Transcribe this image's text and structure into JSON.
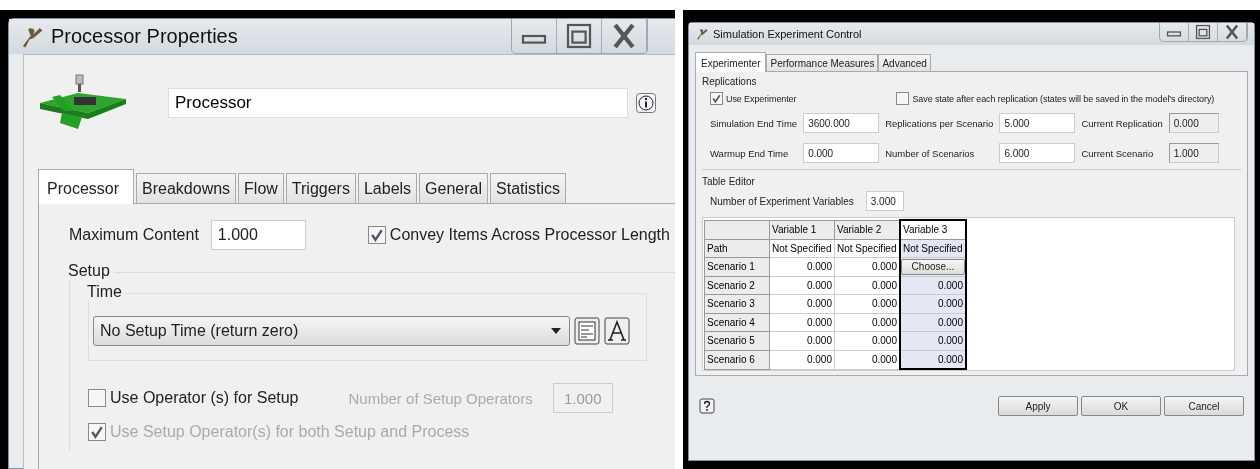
{
  "processor_properties": {
    "title": "Processor  Properties",
    "name_value": "Processor",
    "tabs": [
      {
        "label": "Processor",
        "selected": true
      },
      {
        "label": "Breakdowns",
        "selected": false
      },
      {
        "label": "Flow",
        "selected": false
      },
      {
        "label": "Triggers",
        "selected": false
      },
      {
        "label": "Labels",
        "selected": false
      },
      {
        "label": "General",
        "selected": false
      },
      {
        "label": "Statistics",
        "selected": false
      }
    ],
    "maximum_content": {
      "label": "Maximum Content",
      "value": "1.000"
    },
    "convey_items": {
      "label": "Convey Items Across Processor Length",
      "checked": true
    },
    "setup": {
      "label": "Setup",
      "time": {
        "label": "Time",
        "value": "No Setup Time (return zero)"
      },
      "use_operator": {
        "label": "Use Operator (s) for Setup",
        "checked": false
      },
      "number_of_operators": {
        "label": "Number of Setup Operators",
        "value": "1.000",
        "disabled": true
      },
      "use_setup_operator": {
        "label": "Use Setup Operator(s) for both Setup and Process",
        "checked": true,
        "disabled": true
      }
    }
  },
  "experiment_control": {
    "title": "Simulation Experiment Control",
    "tabs": [
      {
        "label": "Experimenter",
        "selected": true
      },
      {
        "label": "Performance Measures",
        "selected": false
      },
      {
        "label": "Advanced",
        "selected": false
      }
    ],
    "replications": {
      "label": "Replications",
      "use_experimenter": {
        "label": "Use Experimenter",
        "checked": true
      },
      "save_state": {
        "label": "Save state after each replication  (states will be saved in the model's directory)",
        "checked": false
      },
      "fields": [
        {
          "label": "Simulation End Time",
          "value": "3600.000",
          "disabled": false
        },
        {
          "label": "Replications per Scenario",
          "value": "5.000",
          "disabled": false
        },
        {
          "label": "Current Replication",
          "value": "0.000",
          "disabled": true
        },
        {
          "label": "Warmup End Time",
          "value": "0.000",
          "disabled": false
        },
        {
          "label": "Number of Scenarios",
          "value": "6.000",
          "disabled": false
        },
        {
          "label": "Current Scenario",
          "value": "1.000",
          "disabled": true
        }
      ]
    },
    "table_editor": {
      "label": "Table Editor",
      "number_of_variables": {
        "label": "Number of Experiment Variables",
        "value": "3.000"
      },
      "columns": [
        {
          "label": "Variable 1",
          "selected": false
        },
        {
          "label": "Variable 2",
          "selected": false
        },
        {
          "label": "Variable 3",
          "selected": true
        }
      ],
      "rows": [
        {
          "label": "Path",
          "cells": [
            {
              "kind": "text",
              "text": "Not Specified"
            },
            {
              "kind": "text",
              "text": "Not Specified"
            },
            {
              "kind": "text",
              "text": "Not Specified"
            }
          ]
        },
        {
          "label": "Scenario 1",
          "cells": [
            {
              "kind": "number",
              "text": "0.000"
            },
            {
              "kind": "number",
              "text": "0.000"
            },
            {
              "kind": "button",
              "text": "Choose..."
            }
          ]
        },
        {
          "label": "Scenario 2",
          "cells": [
            {
              "kind": "number",
              "text": "0.000"
            },
            {
              "kind": "number",
              "text": "0.000"
            },
            {
              "kind": "number",
              "text": "0.000"
            }
          ]
        },
        {
          "label": "Scenario 3",
          "cells": [
            {
              "kind": "number",
              "text": "0.000"
            },
            {
              "kind": "number",
              "text": "0.000"
            },
            {
              "kind": "number",
              "text": "0.000"
            }
          ]
        },
        {
          "label": "Scenario 4",
          "cells": [
            {
              "kind": "number",
              "text": "0.000"
            },
            {
              "kind": "number",
              "text": "0.000"
            },
            {
              "kind": "number",
              "text": "0.000"
            }
          ]
        },
        {
          "label": "Scenario 5",
          "cells": [
            {
              "kind": "number",
              "text": "0.000"
            },
            {
              "kind": "number",
              "text": "0.000"
            },
            {
              "kind": "number",
              "text": "0.000"
            }
          ]
        },
        {
          "label": "Scenario 6",
          "cells": [
            {
              "kind": "number",
              "text": "0.000"
            },
            {
              "kind": "number",
              "text": "0.000"
            },
            {
              "kind": "number",
              "text": "0.000"
            }
          ]
        }
      ]
    },
    "buttons": [
      "Apply",
      "OK",
      "Cancel"
    ]
  }
}
